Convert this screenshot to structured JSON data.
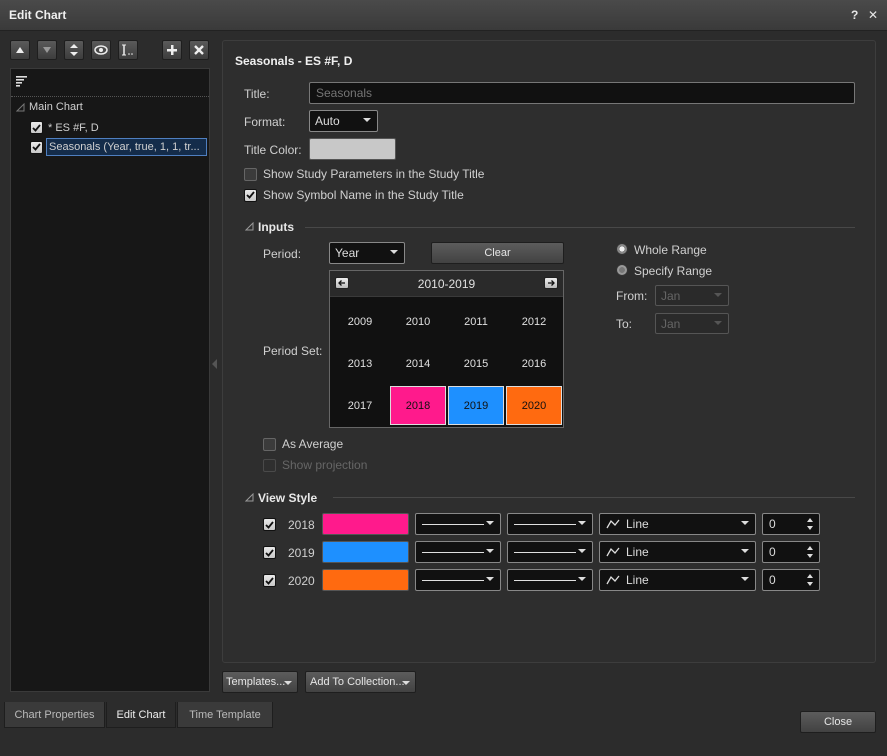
{
  "window": {
    "title": "Edit Chart",
    "help": "?",
    "close": "✕"
  },
  "left_panel": {
    "tree": [
      {
        "label": "Main Chart"
      },
      {
        "label": "* ES #F, D",
        "checked": true
      },
      {
        "label": "Seasonals (Year, true, 1, 1, tr...",
        "checked": true,
        "selected": true
      }
    ]
  },
  "panel": {
    "heading": "Seasonals - ES #F, D",
    "title_label": "Title:",
    "title_placeholder": "Seasonals",
    "format_label": "Format:",
    "format_value": "Auto",
    "title_color_label": "Title Color:",
    "title_color": "#c8c8c8",
    "show_params": {
      "label": "Show Study Parameters in the Study Title",
      "checked": false
    },
    "show_symbol": {
      "label": "Show Symbol Name in the Study Title",
      "checked": true
    }
  },
  "inputs": {
    "heading": "Inputs",
    "period_label": "Period:",
    "period_value": "Year",
    "clear_label": "Clear",
    "period_set_label": "Period Set:",
    "whole_range_label": "Whole Range",
    "specify_range_label": "Specify Range",
    "from_label": "From:",
    "from_value": "Jan",
    "to_label": "To:",
    "to_value": "Jan",
    "calendar": {
      "range": "2010-2019",
      "years": [
        {
          "year": "2009",
          "color": ""
        },
        {
          "year": "2010",
          "color": ""
        },
        {
          "year": "2011",
          "color": ""
        },
        {
          "year": "2012",
          "color": ""
        },
        {
          "year": "2013",
          "color": ""
        },
        {
          "year": "2014",
          "color": ""
        },
        {
          "year": "2015",
          "color": ""
        },
        {
          "year": "2016",
          "color": ""
        },
        {
          "year": "2017",
          "color": ""
        },
        {
          "year": "2018",
          "color": "#ff1a8c"
        },
        {
          "year": "2019",
          "color": "#1e90ff"
        },
        {
          "year": "2020",
          "color": "#ff6a10"
        }
      ]
    },
    "as_average": {
      "label": "As Average",
      "checked": false
    },
    "show_projection": {
      "label": "Show projection",
      "checked": false
    }
  },
  "view_style": {
    "heading": "View Style",
    "rows": [
      {
        "year": "2018",
        "color": "#ff1a8c",
        "type": "Line",
        "offset": "0"
      },
      {
        "year": "2019",
        "color": "#1e90ff",
        "type": "Line",
        "offset": "0"
      },
      {
        "year": "2020",
        "color": "#ff6a10",
        "type": "Line",
        "offset": "0"
      }
    ]
  },
  "footer": {
    "templates_label": "Templates...",
    "add_collection_label": "Add To Collection...",
    "close_label": "Close",
    "tabs": [
      "Chart Properties",
      "Edit Chart",
      "Time Template"
    ]
  }
}
